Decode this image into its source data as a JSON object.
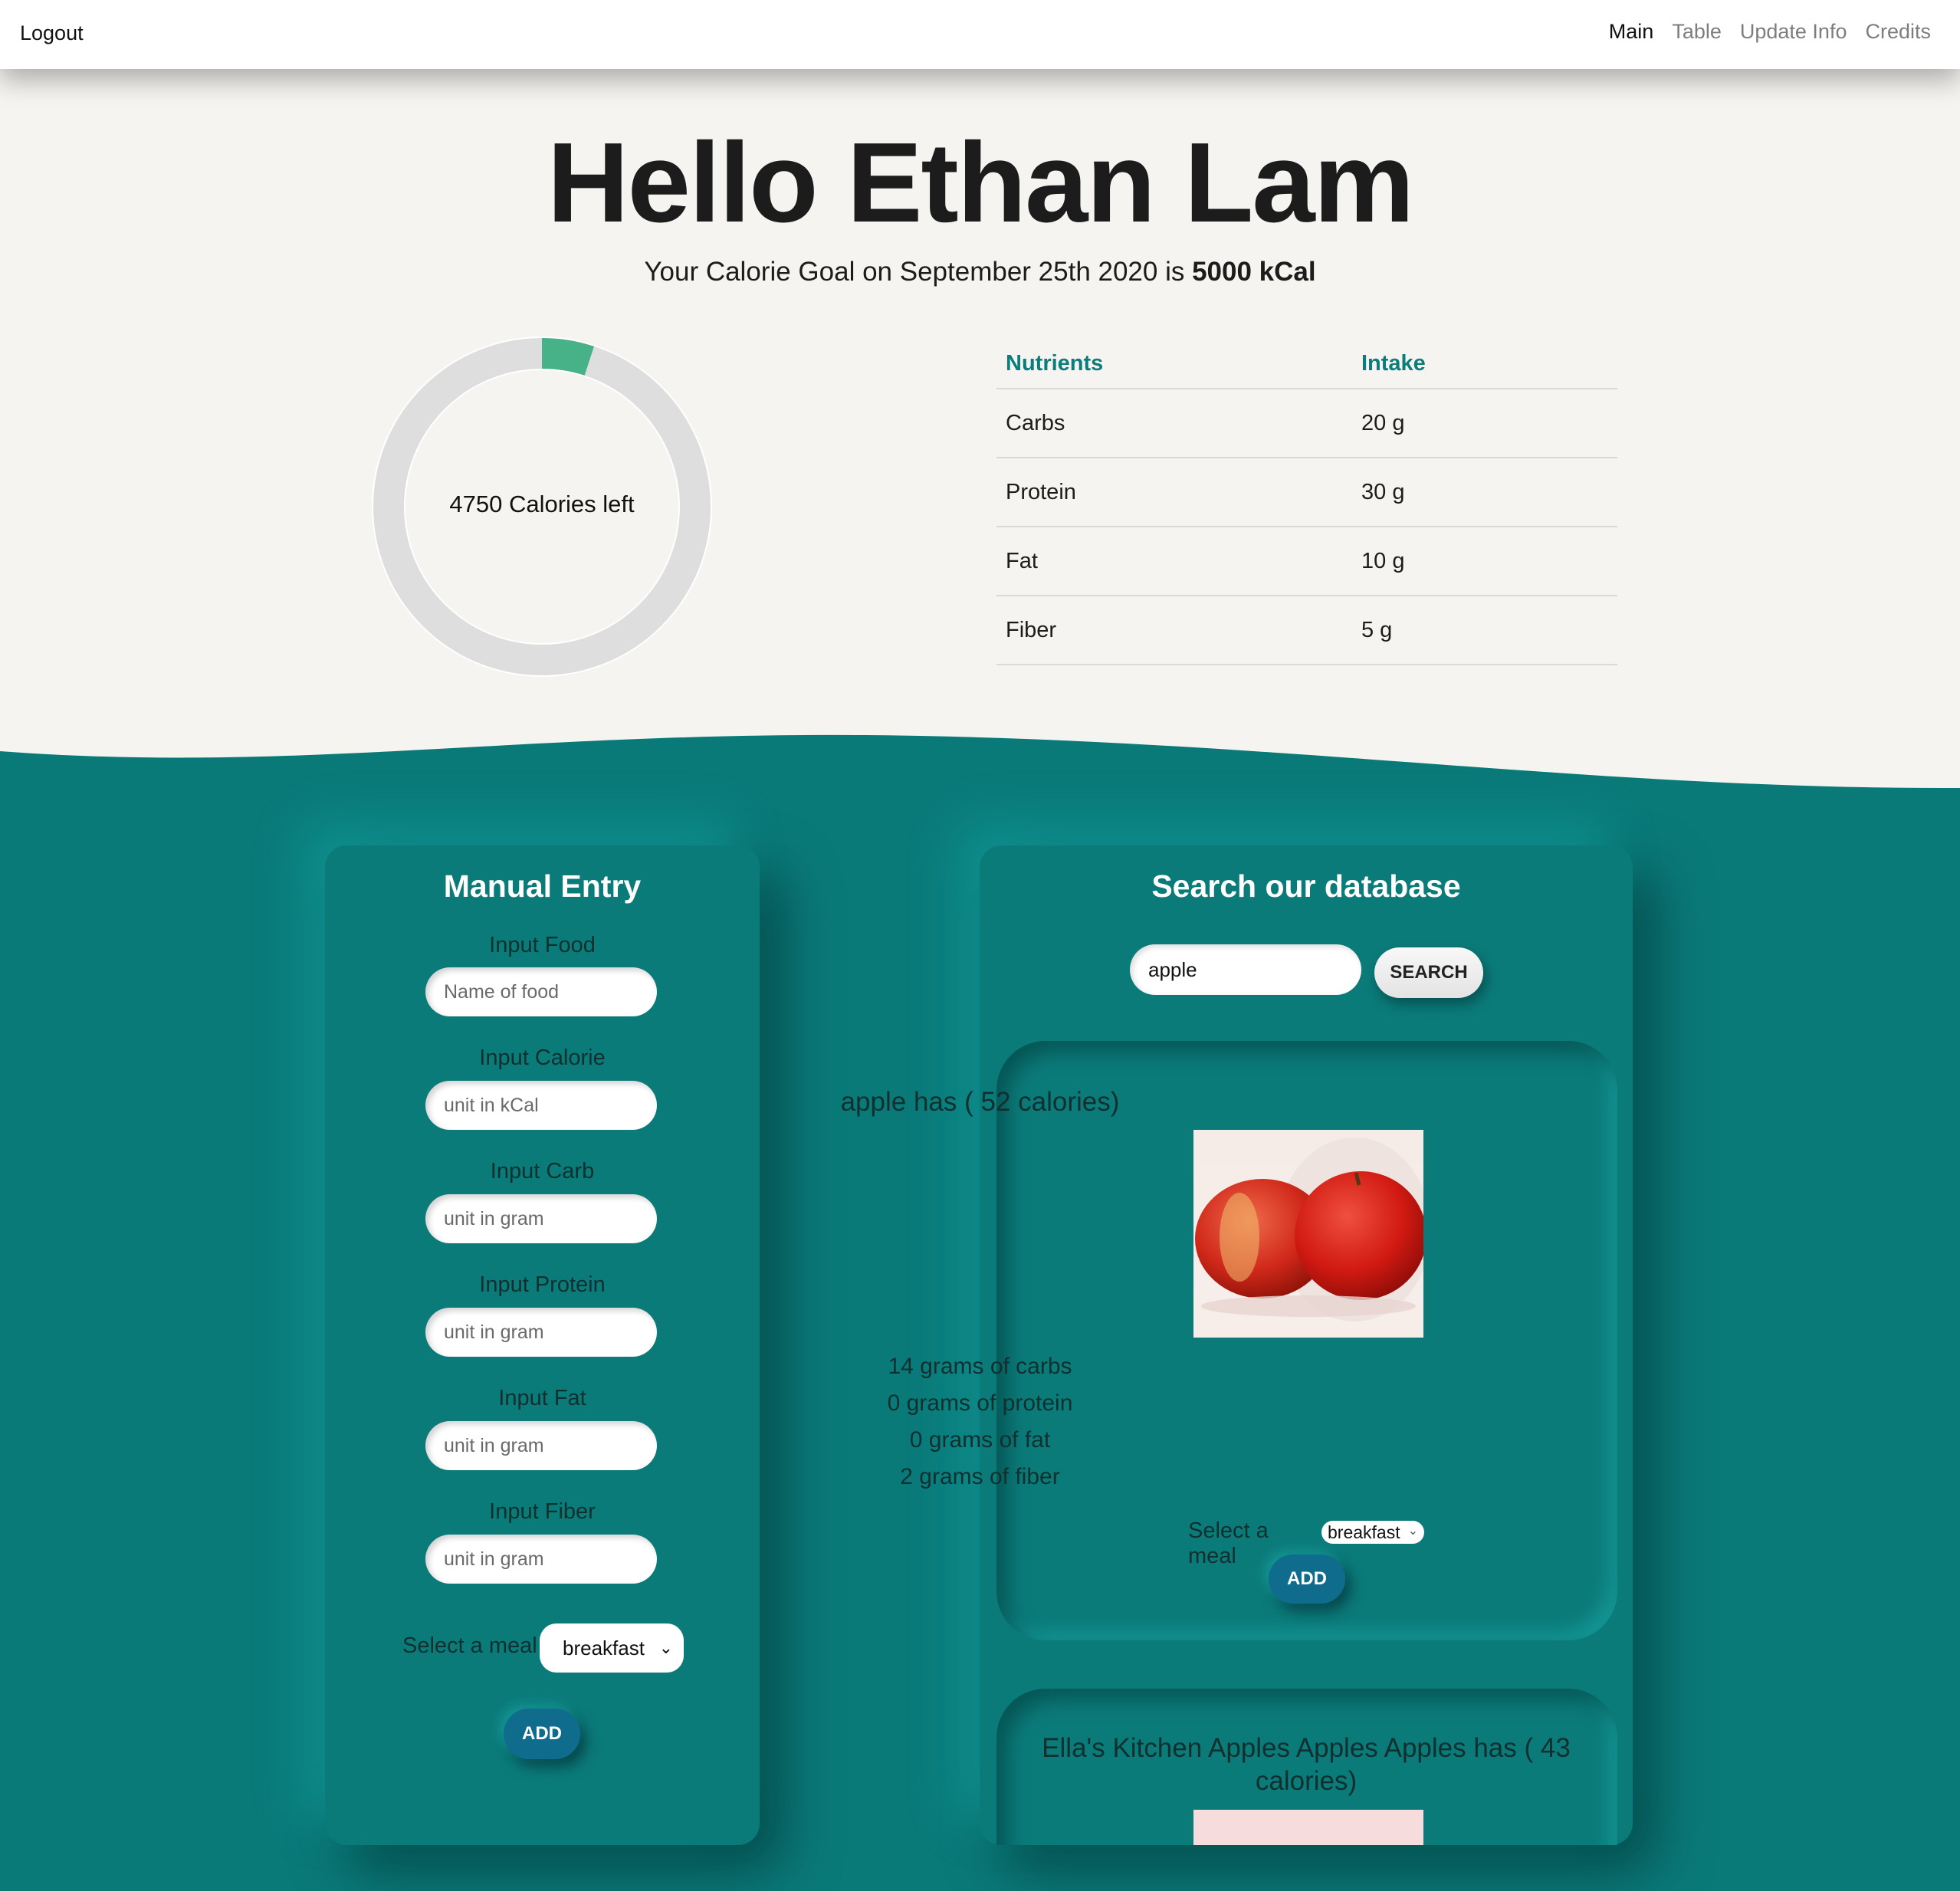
{
  "nav": {
    "logout": "Logout",
    "links": [
      "Main",
      "Table",
      "Update Info",
      "Credits"
    ],
    "active": "Main"
  },
  "header": {
    "greeting": "Hello Ethan Lam",
    "goal_prefix": "Your Calorie Goal on September 25th 2020 is ",
    "goal_value": "5000 kCal"
  },
  "calories": {
    "label": "4750 Calories left",
    "consumed_fraction": 0.05,
    "colors": {
      "consumed": "#47b187",
      "remaining": "#dedede"
    }
  },
  "nutrients": {
    "headers": [
      "Nutrients",
      "Intake"
    ],
    "rows": [
      [
        "Carbs",
        "20 g"
      ],
      [
        "Protein",
        "30 g"
      ],
      [
        "Fat",
        "10 g"
      ],
      [
        "Fiber",
        "5 g"
      ]
    ]
  },
  "manual": {
    "title": "Manual Entry",
    "fields": [
      {
        "label": "Input Food",
        "placeholder": "Name of food"
      },
      {
        "label": "Input Calorie",
        "placeholder": "unit in kCal"
      },
      {
        "label": "Input Carb",
        "placeholder": "unit in gram"
      },
      {
        "label": "Input Protein",
        "placeholder": "unit in gram"
      },
      {
        "label": "Input Fat",
        "placeholder": "unit in gram"
      },
      {
        "label": "Input Fiber",
        "placeholder": "unit in gram"
      }
    ],
    "meal_label": "Select a meal",
    "meal_value": "breakfast",
    "add": "ADD"
  },
  "search": {
    "title": "Search our database",
    "query": "apple",
    "button": "SEARCH",
    "results": [
      {
        "title": "apple has ( 52 calories)",
        "lines": [
          "14 grams of carbs",
          "0 grams of protein",
          "0 grams of fat",
          "2 grams of fiber"
        ],
        "meal_label": "Select a meal",
        "meal_value": "breakfast",
        "add": "ADD"
      },
      {
        "title_line1": "Ella's Kitchen Apples Apples Apples has ( 43",
        "title_line2": "calories)"
      }
    ]
  }
}
